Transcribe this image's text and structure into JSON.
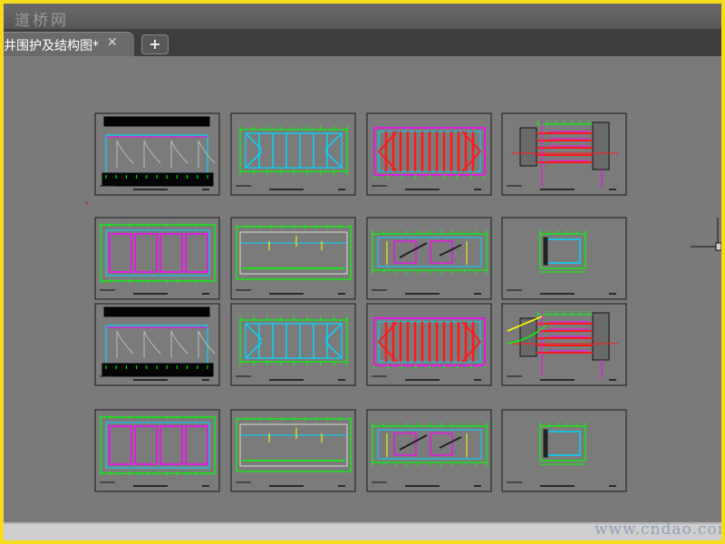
{
  "window": {
    "brand": "道桥网"
  },
  "tabs": [
    {
      "label": "井围护及结构图*",
      "close_icon": "close-icon"
    }
  ],
  "new_tab_label": "+",
  "watermark": "www.cndao.com",
  "colors": {
    "background": "#7a7a7a",
    "sheet_border": "#1a1a1a",
    "green": "#00ff00",
    "cyan": "#00d8ff",
    "magenta": "#ff00ff",
    "red": "#ff1a1a",
    "yellow": "#ffff00",
    "white": "#ffffff"
  },
  "drawing_sheets": [
    {
      "row": 1,
      "col": 1,
      "kind": "elevation-piles"
    },
    {
      "row": 1,
      "col": 2,
      "kind": "plan-bracing"
    },
    {
      "row": 1,
      "col": 3,
      "kind": "plan-red"
    },
    {
      "row": 1,
      "col": 4,
      "kind": "section-anchors"
    },
    {
      "row": 2,
      "col": 1,
      "kind": "frame-magenta"
    },
    {
      "row": 2,
      "col": 2,
      "kind": "long-section"
    },
    {
      "row": 2,
      "col": 3,
      "kind": "rebar-detail"
    },
    {
      "row": 2,
      "col": 4,
      "kind": "small-detail"
    },
    {
      "row": 3,
      "col": 1,
      "kind": "elevation-piles"
    },
    {
      "row": 3,
      "col": 2,
      "kind": "plan-bracing"
    },
    {
      "row": 3,
      "col": 3,
      "kind": "plan-red"
    },
    {
      "row": 3,
      "col": 4,
      "kind": "section-anchors-yellow"
    },
    {
      "row": 4,
      "col": 1,
      "kind": "frame-magenta"
    },
    {
      "row": 4,
      "col": 2,
      "kind": "long-section"
    },
    {
      "row": 4,
      "col": 3,
      "kind": "rebar-detail"
    },
    {
      "row": 4,
      "col": 4,
      "kind": "small-detail"
    }
  ]
}
